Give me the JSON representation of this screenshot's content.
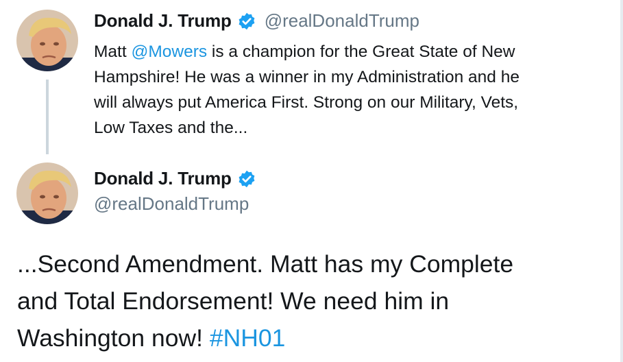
{
  "tweet_1": {
    "author": {
      "display_name": "Donald J. Trump",
      "handle": "@realDonaldTrump",
      "verified": true
    },
    "text": {
      "line_1_pre": "Matt ",
      "mention": "@Mowers",
      "line_1_post": " is a champion for the Great State of New",
      "line_2": "Hampshire! He was a winner in my Administration and he",
      "line_3": "will always put America First. Strong on our Military, Vets,",
      "line_4": "Low Taxes and the..."
    }
  },
  "tweet_2": {
    "author": {
      "display_name": "Donald J. Trump",
      "handle": "@realDonaldTrump",
      "verified": true
    },
    "text": {
      "line_1": "...Second Amendment. Matt has my Complete",
      "line_2": "and Total Endorsement! We need him in",
      "line_3_pre": "Washington now! ",
      "hashtag": "#NH01"
    }
  },
  "icons": {
    "verified": "verified-badge-icon",
    "avatar": "profile-photo"
  },
  "colors": {
    "link": "#1b95e0",
    "verified": "#1da1f2",
    "text": "#14171a",
    "secondary": "#657786",
    "thread_line": "#ccd6dd"
  }
}
